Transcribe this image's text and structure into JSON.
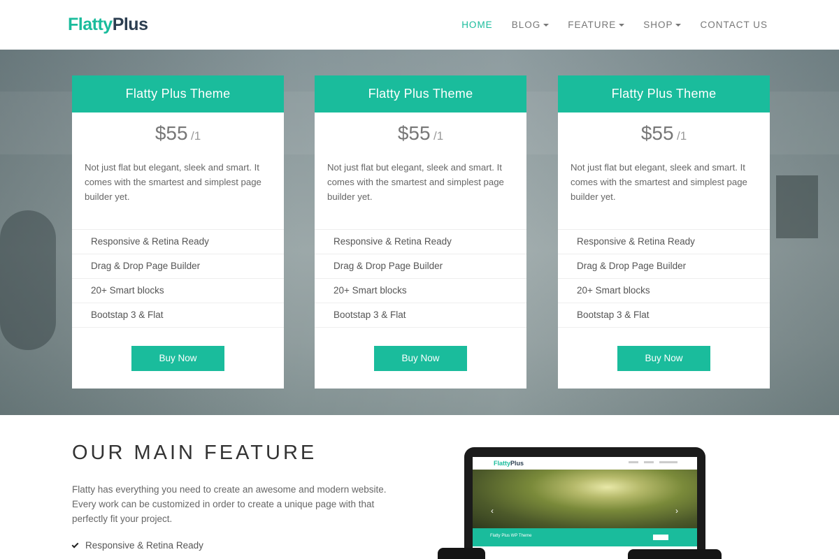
{
  "header": {
    "logo_part1": "Flatty",
    "logo_part2": "Plus",
    "nav": [
      {
        "label": "HOME"
      },
      {
        "label": "BLOG"
      },
      {
        "label": "FEATURE"
      },
      {
        "label": "SHOP"
      },
      {
        "label": "CONTACT US"
      }
    ]
  },
  "pricing": {
    "cards": [
      {
        "title": "Flatty Plus Theme",
        "price": "$55",
        "period": "/1",
        "description": "Not just flat but elegant, sleek and smart. It comes with the smartest and simplest page builder yet.",
        "features": [
          "Responsive & Retina Ready",
          "Drag & Drop Page Builder",
          "20+ Smart blocks",
          "Bootstap 3 & Flat"
        ],
        "button": "Buy Now"
      },
      {
        "title": "Flatty Plus Theme",
        "price": "$55",
        "period": "/1",
        "description": "Not just flat but elegant, sleek and smart. It comes with the smartest and simplest page builder yet.",
        "features": [
          "Responsive & Retina Ready",
          "Drag & Drop Page Builder",
          "20+ Smart blocks",
          "Bootstap 3 & Flat"
        ],
        "button": "Buy Now"
      },
      {
        "title": "Flatty Plus Theme",
        "price": "$55",
        "period": "/1",
        "description": "Not just flat but elegant, sleek and smart. It comes with the smartest and simplest page builder yet.",
        "features": [
          "Responsive & Retina Ready",
          "Drag & Drop Page Builder",
          "20+ Smart blocks",
          "Bootstap 3 & Flat"
        ],
        "button": "Buy Now"
      }
    ]
  },
  "main_feature": {
    "title": "OUR MAIN FEATURE",
    "description": "Flatty has everything you need to create an awesome and modern website. Every work can be customized in order to create a unique page with that perfectly fit your project.",
    "items": [
      "Responsive & Retina Ready"
    ]
  },
  "device_preview": {
    "logo_part1": "Flatty",
    "logo_part2": "Plus",
    "band_text": "Flatty Plus WP Theme"
  },
  "colors": {
    "accent": "#1abc9c",
    "logo_dark": "#2c3e50",
    "text": "#555555"
  }
}
